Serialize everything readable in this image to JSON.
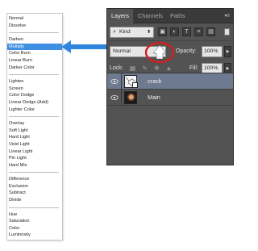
{
  "blend_modes": {
    "groups": [
      [
        "Normal",
        "Dissolve"
      ],
      [
        "Darken",
        "Multiply",
        "Color Burn",
        "Linear Burn",
        "Darker Color"
      ],
      [
        "Lighten",
        "Screen",
        "Color Dodge",
        "Linear Dodge (Add)",
        "Lighter Color"
      ],
      [
        "Overlay",
        "Soft Light",
        "Hard Light",
        "Vivid Light",
        "Linear Light",
        "Pin Light",
        "Hard Mix"
      ],
      [
        "Difference",
        "Exclusion",
        "Subtract",
        "Divide"
      ],
      [
        "Hue",
        "Saturation",
        "Color",
        "Luminosity"
      ]
    ],
    "selected": "Multiply"
  },
  "panel": {
    "tabs": [
      {
        "label": "Layers",
        "active": true
      },
      {
        "label": "Channels",
        "active": false
      },
      {
        "label": "Paths",
        "active": false
      }
    ],
    "filter": {
      "kind_label": "Kind"
    },
    "blend_select": "Normal",
    "opacity_label": "Opacity:",
    "opacity_value": "100%",
    "lock_label": "Lock:",
    "fill_label": "Fill:",
    "fill_value": "100%",
    "layers": [
      {
        "name": "crack",
        "selected": true
      },
      {
        "name": "Main",
        "selected": false
      }
    ]
  },
  "colors": {
    "selection_blue": "#3d8fe2",
    "arrow_blue": "#2e86de",
    "highlight_circle": "#d11f1f",
    "panel_bg": "#535353"
  }
}
